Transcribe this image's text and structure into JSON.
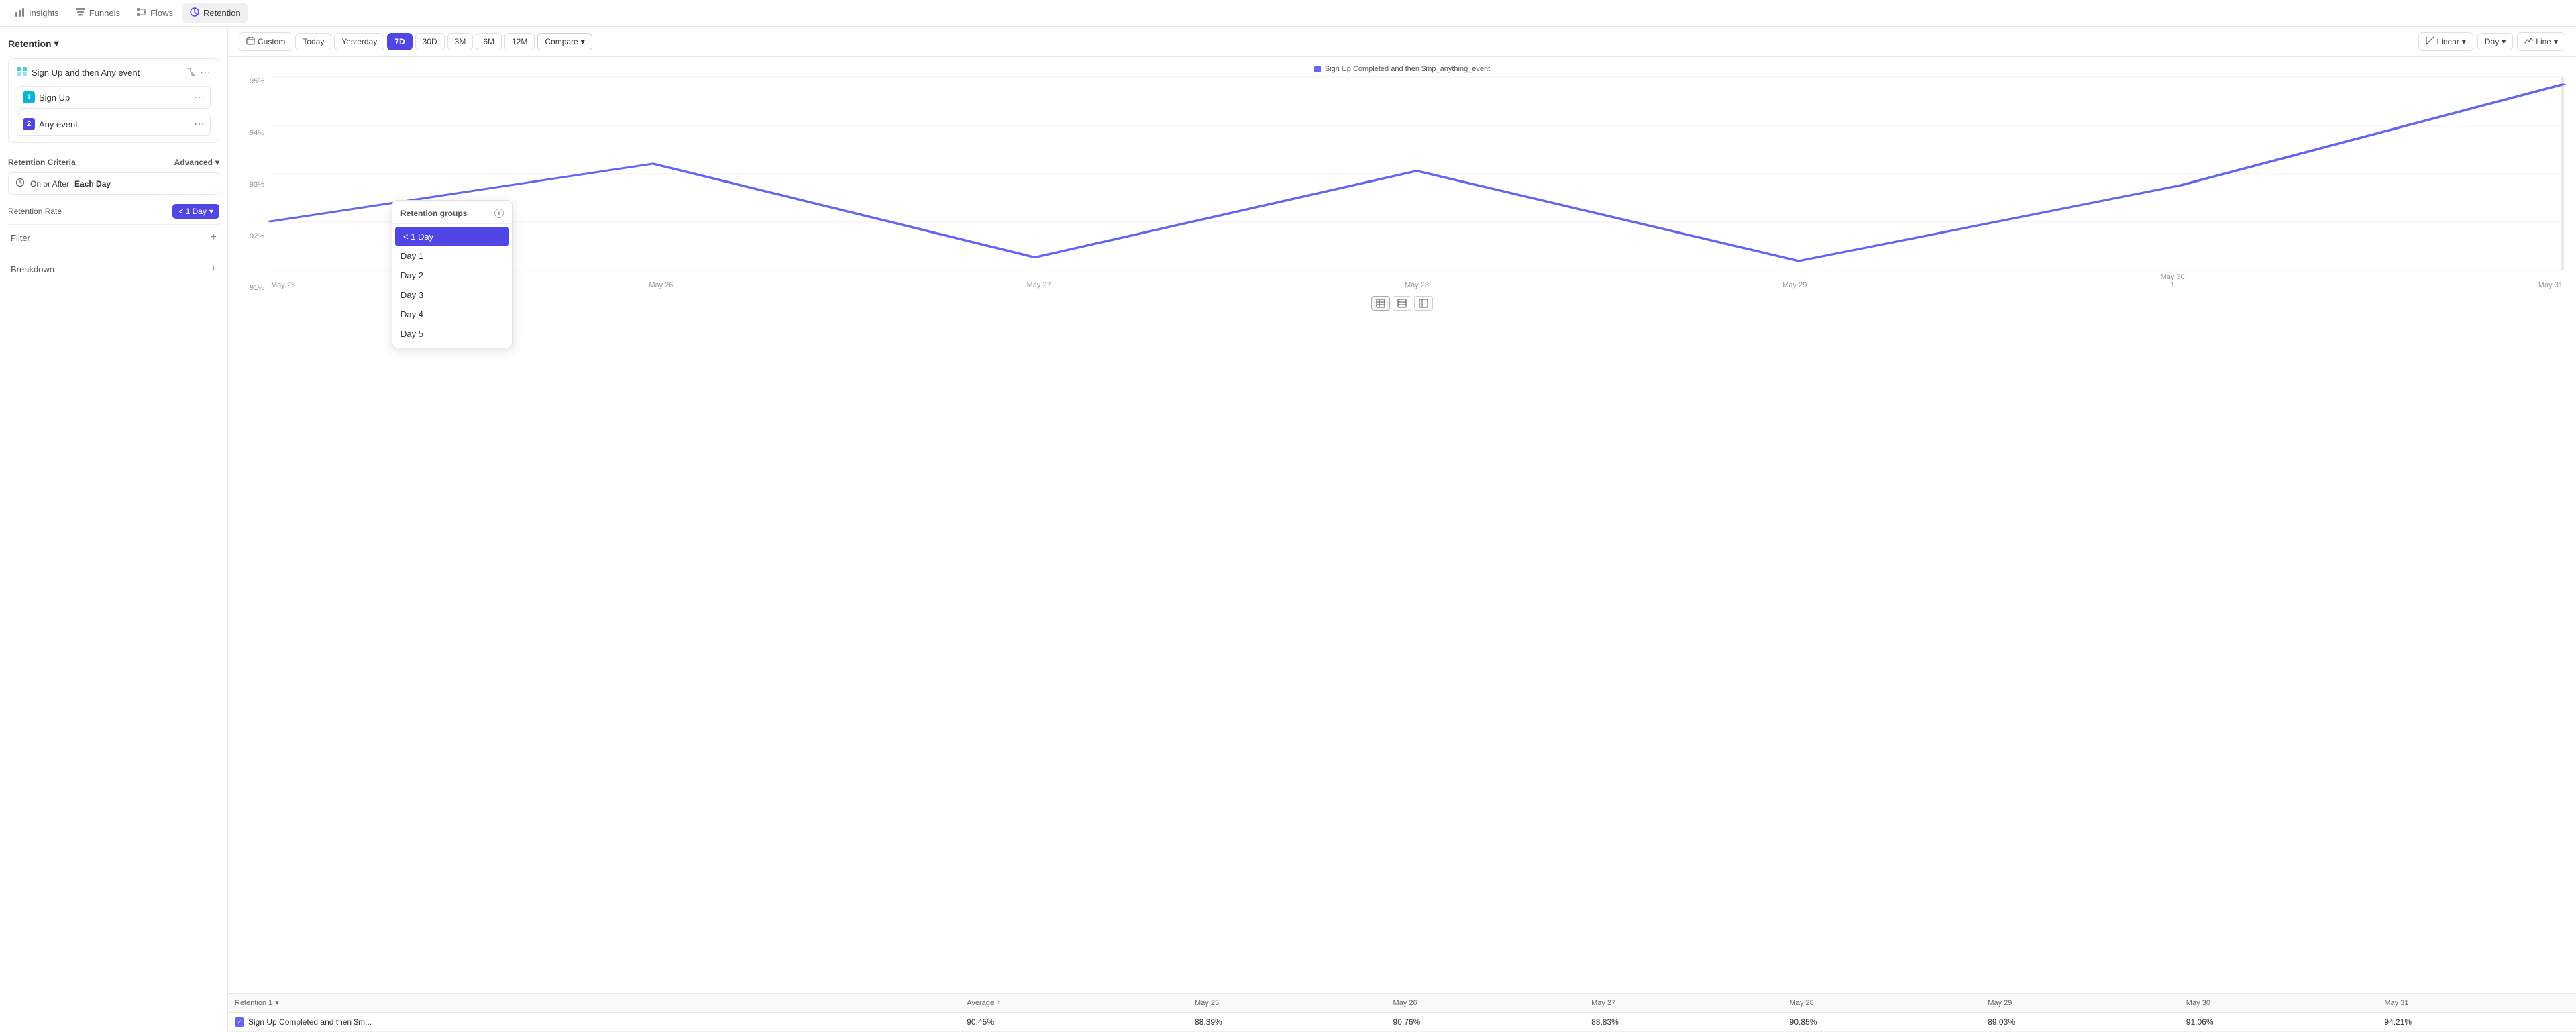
{
  "nav": {
    "items": [
      {
        "id": "insights",
        "label": "Insights",
        "icon": "insights-icon",
        "active": false
      },
      {
        "id": "funnels",
        "label": "Funnels",
        "icon": "funnels-icon",
        "active": false
      },
      {
        "id": "flows",
        "label": "Flows",
        "icon": "flows-icon",
        "active": false
      },
      {
        "id": "retention",
        "label": "Retention",
        "icon": "retention-icon",
        "active": true
      }
    ]
  },
  "sidebar": {
    "title": "Retention",
    "dropdown_arrow": "▾",
    "event_group": {
      "label": "Sign Up and then Any event",
      "events": [
        {
          "num": "1",
          "label": "Sign Up",
          "color": "teal"
        },
        {
          "num": "2",
          "label": "Any event",
          "color": "blue"
        }
      ]
    },
    "retention_criteria": {
      "section_label": "Retention Criteria",
      "advanced_label": "Advanced",
      "criteria": {
        "icon": "clock-icon",
        "on_or_after": "On or After",
        "each_day": "Each Day"
      }
    },
    "retention_rate": {
      "label": "Retention Rate",
      "value": "< 1 Day"
    },
    "filter": {
      "label": "Filter",
      "icon": "plus-icon"
    },
    "breakdown": {
      "label": "Breakdown",
      "icon": "plus-icon"
    }
  },
  "toolbar": {
    "date_icon": "calendar-icon",
    "custom": "Custom",
    "today": "Today",
    "yesterday": "Yesterday",
    "7d": "7D",
    "30d": "30D",
    "3m": "3M",
    "6m": "6M",
    "12m": "12M",
    "compare": "Compare",
    "linear": "Linear",
    "day": "Day",
    "line": "Line"
  },
  "chart": {
    "legend": "Sign Up Completed and then $mp_anything_event",
    "y_axis": [
      "95%",
      "94%",
      "93%",
      "92%",
      "91%"
    ],
    "x_axis": [
      "May 25",
      "May 26",
      "May 27",
      "May 28",
      "May 29",
      "May 30",
      "May 31"
    ],
    "annotation": "1",
    "line_color": "#6366f1"
  },
  "table": {
    "columns": [
      "Retention 1",
      "Average",
      "May 25",
      "May 26",
      "May 27",
      "May 28",
      "May 29",
      "May 30",
      "May 31"
    ],
    "rows": [
      {
        "label": "Sign Up Completed and then $m...",
        "average": "90.45%",
        "may25": "88.39%",
        "may26": "90.76%",
        "may27": "88.83%",
        "may28": "90.85%",
        "may29": "89.03%",
        "may30": "91.06%",
        "may31": "94.21%"
      }
    ]
  },
  "dropdown": {
    "header": "Retention groups",
    "items": [
      {
        "label": "< 1 Day",
        "selected": true
      },
      {
        "label": "Day 1",
        "selected": false
      },
      {
        "label": "Day 2",
        "selected": false
      },
      {
        "label": "Day 3",
        "selected": false
      },
      {
        "label": "Day 4",
        "selected": false
      },
      {
        "label": "Day 5",
        "selected": false
      }
    ]
  }
}
